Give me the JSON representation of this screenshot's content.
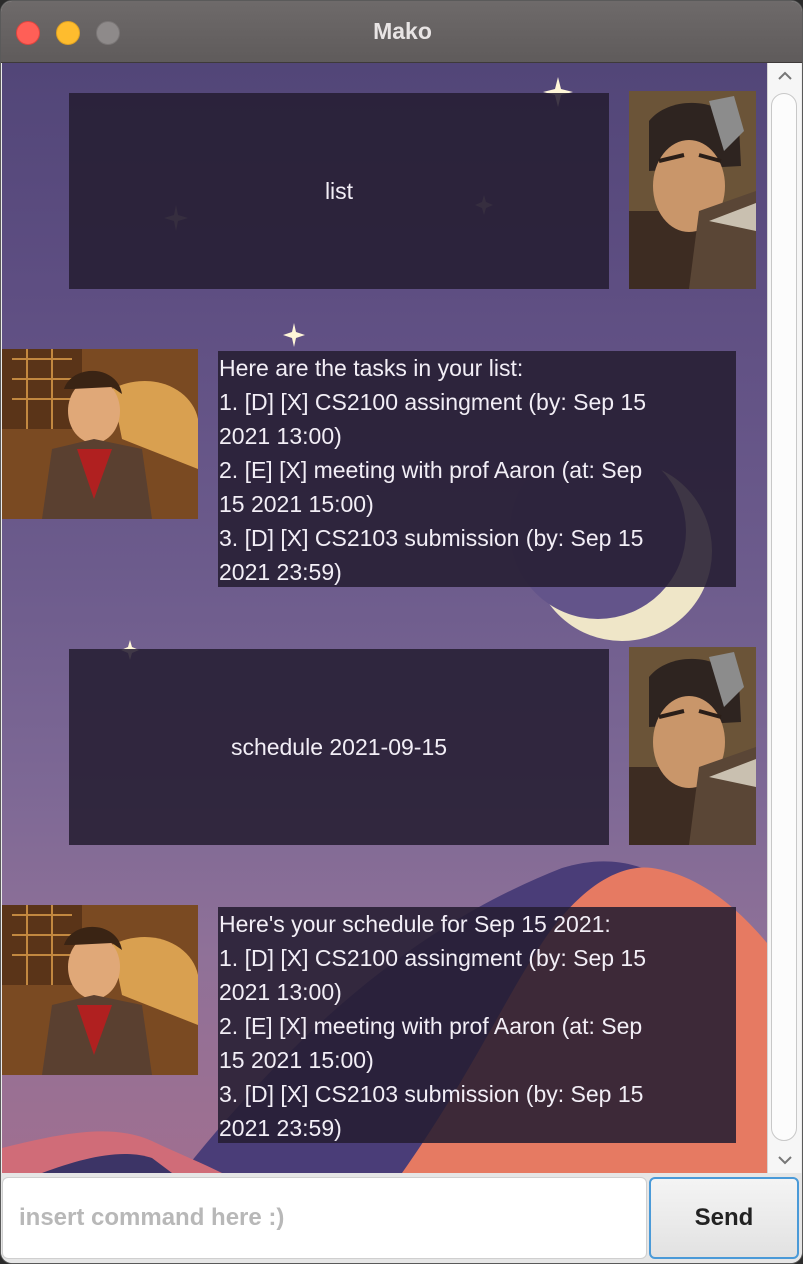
{
  "window": {
    "title": "Mako"
  },
  "colors": {
    "close": "#ff5f57",
    "minimize": "#febc2e",
    "zoom_disabled": "#8e8a8a",
    "bubble_bg": "#261e32",
    "send_border": "#4a9ad8"
  },
  "messages": [
    {
      "sender": "user",
      "text": "list",
      "avatar": "mako-avatar"
    },
    {
      "sender": "bot",
      "avatar": "bolin-avatar",
      "lines": [
        "Here are the tasks in your list:",
        "1. [D] [X] CS2100 assingment (by: Sep 15",
        "2021 13:00)",
        "2. [E] [X] meeting with prof Aaron (at: Sep",
        "15 2021 15:00)",
        "3. [D] [X] CS2103 submission (by: Sep 15",
        "2021 23:59)"
      ]
    },
    {
      "sender": "user",
      "text": "schedule 2021-09-15",
      "avatar": "mako-avatar"
    },
    {
      "sender": "bot",
      "avatar": "bolin-avatar",
      "lines": [
        "Here's your schedule for Sep 15 2021:",
        "1. [D] [X] CS2100 assingment (by: Sep 15",
        "2021 13:00)",
        "2. [E] [X] meeting with prof Aaron (at: Sep",
        "15 2021 15:00)",
        "3. [D] [X] CS2103 submission (by: Sep 15",
        "2021 23:59)"
      ]
    }
  ],
  "input": {
    "placeholder": "insert command here :)",
    "value": ""
  },
  "send_button": {
    "label": "Send"
  },
  "icons": {
    "scroll_up": "chevron-up-icon",
    "scroll_down": "chevron-down-icon"
  }
}
